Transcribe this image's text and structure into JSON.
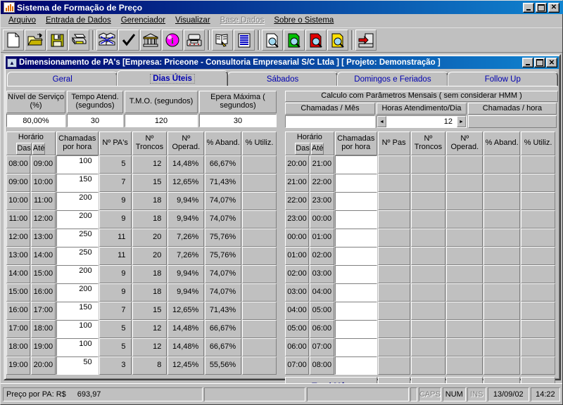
{
  "window": {
    "title": "Sistema de Formação de Preço",
    "buttons": {
      "minimize": "_",
      "maximize": "❐",
      "close": "✕"
    }
  },
  "menu": {
    "items": [
      {
        "label": "Arquivo",
        "disabled": false
      },
      {
        "label": "Entrada de Dados",
        "disabled": false
      },
      {
        "label": "Gerenciador",
        "disabled": false
      },
      {
        "label": "Visualizar",
        "disabled": false
      },
      {
        "label": "Base Dados",
        "disabled": true
      },
      {
        "label": "Sobre o Sistema",
        "disabled": false
      }
    ]
  },
  "toolbar": {
    "buttons": [
      {
        "name": "new-document-icon"
      },
      {
        "name": "open-folder-icon"
      },
      {
        "name": "save-disk-icon"
      },
      {
        "name": "print-icon"
      },
      {
        "sep": true
      },
      {
        "name": "network-sites-icon"
      },
      {
        "name": "check-icon"
      },
      {
        "name": "bank-building-icon"
      },
      {
        "name": "info-icon"
      },
      {
        "name": "telephone-icon"
      },
      {
        "sep": true
      },
      {
        "name": "report-book-icon"
      },
      {
        "name": "list-lines-icon"
      },
      {
        "sep": true
      },
      {
        "name": "preview-white-icon"
      },
      {
        "name": "preview-green-icon"
      },
      {
        "name": "preview-red-icon"
      },
      {
        "name": "preview-yellow-icon"
      },
      {
        "sep": true
      },
      {
        "name": "exit-door-icon"
      }
    ]
  },
  "child_window": {
    "title": "Dimensionamento de PA's [Empresa: Priceone - Consultoria Empresarial S/C Ltda ] [ Projeto: Demonstração ]",
    "buttons": {
      "minimize": "_",
      "maximize": "❐",
      "close": "✕"
    }
  },
  "tabs": [
    {
      "label": "Geral",
      "active": false
    },
    {
      "label": "Dias Úteis",
      "active": true
    },
    {
      "label": "Sábados",
      "active": false
    },
    {
      "label": "Domingos e Feriados",
      "active": false
    },
    {
      "label": "Follow Up",
      "active": false
    }
  ],
  "left_params": {
    "headers": [
      "Nível de\nServiço (%)",
      "Tempo Atend.\n(segundos)",
      "T.M.O.\n(segundos)",
      "Epera Máxima\n( segundos)"
    ],
    "values": [
      "80,00%",
      "30",
      "120",
      "30"
    ]
  },
  "right_params": {
    "title": "Calculo com Parâmetros Mensais ( sem considerar HMM )",
    "headers": [
      "Chamadas / Mês",
      "Horas Atendimento/Dia",
      "Chamadas / hora"
    ],
    "calls_per_month": "",
    "hours_per_day": "12",
    "calls_per_hour": "",
    "spin_left": "◄",
    "spin_right": "►"
  },
  "left_table": {
    "headers": {
      "horario": "Horário",
      "das": "Das",
      "ate": "Até",
      "chamadas": "Chamadas\npor hora",
      "pas": "Nº  PA's",
      "troncos": "Nº\nTroncos",
      "operad": "Nº\nOperad.",
      "aband": "% Aband.",
      "utiliz": "%     Utiliz."
    },
    "rows": [
      {
        "das": "08:00",
        "ate": "09:00",
        "chamadas": "100",
        "pas": "5",
        "troncos": "12",
        "operad": "14,48%",
        "aband": "66,67%",
        "utiliz": ""
      },
      {
        "das": "09:00",
        "ate": "10:00",
        "chamadas": "150",
        "pas": "7",
        "troncos": "15",
        "operad": "12,65%",
        "aband": "71,43%",
        "utiliz": ""
      },
      {
        "das": "10:00",
        "ate": "11:00",
        "chamadas": "200",
        "pas": "9",
        "troncos": "18",
        "operad": "9,94%",
        "aband": "74,07%",
        "utiliz": ""
      },
      {
        "das": "11:00",
        "ate": "12:00",
        "chamadas": "200",
        "pas": "9",
        "troncos": "18",
        "operad": "9,94%",
        "aband": "74,07%",
        "utiliz": ""
      },
      {
        "das": "12:00",
        "ate": "13:00",
        "chamadas": "250",
        "pas": "11",
        "troncos": "20",
        "operad": "7,26%",
        "aband": "75,76%",
        "utiliz": ""
      },
      {
        "das": "13:00",
        "ate": "14:00",
        "chamadas": "250",
        "pas": "11",
        "troncos": "20",
        "operad": "7,26%",
        "aband": "75,76%",
        "utiliz": ""
      },
      {
        "das": "14:00",
        "ate": "15:00",
        "chamadas": "200",
        "pas": "9",
        "troncos": "18",
        "operad": "9,94%",
        "aband": "74,07%",
        "utiliz": ""
      },
      {
        "das": "15:00",
        "ate": "16:00",
        "chamadas": "200",
        "pas": "9",
        "troncos": "18",
        "operad": "9,94%",
        "aband": "74,07%",
        "utiliz": ""
      },
      {
        "das": "16:00",
        "ate": "17:00",
        "chamadas": "150",
        "pas": "7",
        "troncos": "15",
        "operad": "12,65%",
        "aband": "71,43%",
        "utiliz": ""
      },
      {
        "das": "17:00",
        "ate": "18:00",
        "chamadas": "100",
        "pas": "5",
        "troncos": "12",
        "operad": "14,48%",
        "aband": "66,67%",
        "utiliz": ""
      },
      {
        "das": "18:00",
        "ate": "19:00",
        "chamadas": "100",
        "pas": "5",
        "troncos": "12",
        "operad": "14,48%",
        "aband": "66,67%",
        "utiliz": ""
      },
      {
        "das": "19:00",
        "ate": "20:00",
        "chamadas": "50",
        "pas": "3",
        "troncos": "8",
        "operad": "12,45%",
        "aband": "55,56%",
        "utiliz": ""
      }
    ]
  },
  "right_table": {
    "headers": {
      "horario": "Horário",
      "das": "Das",
      "ate": "Até",
      "chamadas": "Chamadas\npor hora",
      "pas": "Nº Pas",
      "troncos": "Nº\nTroncos",
      "operad": "Nº\nOperad.",
      "aband": "% Aband.",
      "utiliz": "% Utiliz."
    },
    "rows": [
      {
        "das": "20:00",
        "ate": "21:00",
        "chamadas": "",
        "pas": "",
        "troncos": "",
        "operad": "",
        "aband": "",
        "utiliz": ""
      },
      {
        "das": "21:00",
        "ate": "22:00",
        "chamadas": "",
        "pas": "",
        "troncos": "",
        "operad": "",
        "aband": "",
        "utiliz": ""
      },
      {
        "das": "22:00",
        "ate": "23:00",
        "chamadas": "",
        "pas": "",
        "troncos": "",
        "operad": "",
        "aband": "",
        "utiliz": ""
      },
      {
        "das": "23:00",
        "ate": "00:00",
        "chamadas": "",
        "pas": "",
        "troncos": "",
        "operad": "",
        "aband": "",
        "utiliz": ""
      },
      {
        "das": "00:00",
        "ate": "01:00",
        "chamadas": "",
        "pas": "",
        "troncos": "",
        "operad": "",
        "aband": "",
        "utiliz": ""
      },
      {
        "das": "01:00",
        "ate": "02:00",
        "chamadas": "",
        "pas": "",
        "troncos": "",
        "operad": "",
        "aband": "",
        "utiliz": ""
      },
      {
        "das": "02:00",
        "ate": "03:00",
        "chamadas": "",
        "pas": "",
        "troncos": "",
        "operad": "",
        "aband": "",
        "utiliz": ""
      },
      {
        "das": "03:00",
        "ate": "04:00",
        "chamadas": "",
        "pas": "",
        "troncos": "",
        "operad": "",
        "aband": "",
        "utiliz": ""
      },
      {
        "das": "04:00",
        "ate": "05:00",
        "chamadas": "",
        "pas": "",
        "troncos": "",
        "operad": "",
        "aband": "",
        "utiliz": ""
      },
      {
        "das": "05:00",
        "ate": "06:00",
        "chamadas": "",
        "pas": "",
        "troncos": "",
        "operad": "",
        "aband": "",
        "utiliz": ""
      },
      {
        "das": "06:00",
        "ate": "07:00",
        "chamadas": "",
        "pas": "",
        "troncos": "",
        "operad": "",
        "aband": "",
        "utiliz": ""
      },
      {
        "das": "07:00",
        "ate": "08:00",
        "chamadas": "",
        "pas": "",
        "troncos": "",
        "operad": "",
        "aband": "",
        "utiliz": ""
      }
    ],
    "total_label": "Total Mês",
    "total_values": [
      "",
      "",
      "",
      "",
      ""
    ]
  },
  "statusbar": {
    "price_label": "Preço por PA: R$",
    "price_value": "693,97",
    "panel2": "",
    "panel3": "",
    "panel4": "",
    "caps": "CAPS",
    "num": "NUM",
    "ins": "INS",
    "date": "13/09/02",
    "time": "14:22"
  },
  "colors": {
    "title_start": "#00006b",
    "title_end": "#1084d0",
    "face": "#c0c0c0",
    "tab_text": "#0000b0",
    "total_text": "#000080"
  }
}
